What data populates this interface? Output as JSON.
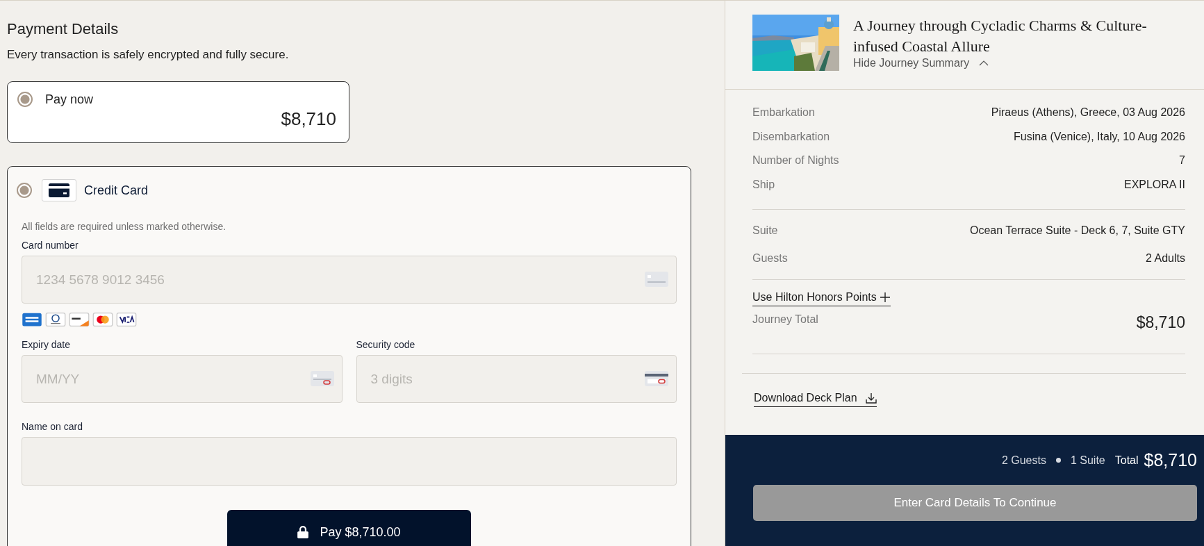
{
  "payment": {
    "title": "Payment Details",
    "subtitle": "Every transaction is safely encrypted and fully secure.",
    "pay_now": {
      "label": "Pay now",
      "amount": "$8,710",
      "selected": true
    },
    "credit_card": {
      "label": "Credit Card",
      "selected": true,
      "note": "All fields are required unless marked otherwise.",
      "fields": [
        {
          "label": "Card number",
          "placeholder": "1234 5678 9012 3456",
          "kind": "card"
        },
        {
          "label": "Expiry date",
          "placeholder": "MM/YY",
          "kind": "expiry"
        },
        {
          "label": "Security code",
          "placeholder": "3 digits",
          "kind": "cvc"
        },
        {
          "label": "Name on card",
          "kind": "name"
        }
      ],
      "pay_button": {
        "label": "Pay $8,710.00",
        "disabled": false
      }
    }
  },
  "summary": {
    "title": "A Journey through Cycladic Charms & Culture-infused Coastal Allure",
    "toggle": "Hide Journey Summary",
    "expanded": true,
    "details": [
      {
        "label": "Embarkation",
        "value": "Piraeus (Athens), Greece, 03 Aug 2026"
      },
      {
        "label": "Disembarkation",
        "value": "Fusina (Venice), Italy, 10 Aug 2026"
      },
      {
        "label": "Number of Nights",
        "value": "7"
      },
      {
        "label": "Ship",
        "value": "EXPLORA II"
      }
    ],
    "suite": [
      {
        "label": "Suite",
        "value": "Ocean Terrace Suite - Deck 6, 7, Suite GTY"
      },
      {
        "label": "Guests",
        "value": "2 Adults"
      }
    ],
    "points_link": "Use Hilton Honors Points",
    "total_label": "Journey Total",
    "total": "$8,710",
    "deck_plan_link": "Download Deck Plan"
  },
  "footer": {
    "guests": "2 Guests",
    "suites": "1 Suite",
    "total_label": "Total",
    "total": "$8,710",
    "continue_button": {
      "label": "Enter Card Details To Continue",
      "disabled": true
    }
  }
}
